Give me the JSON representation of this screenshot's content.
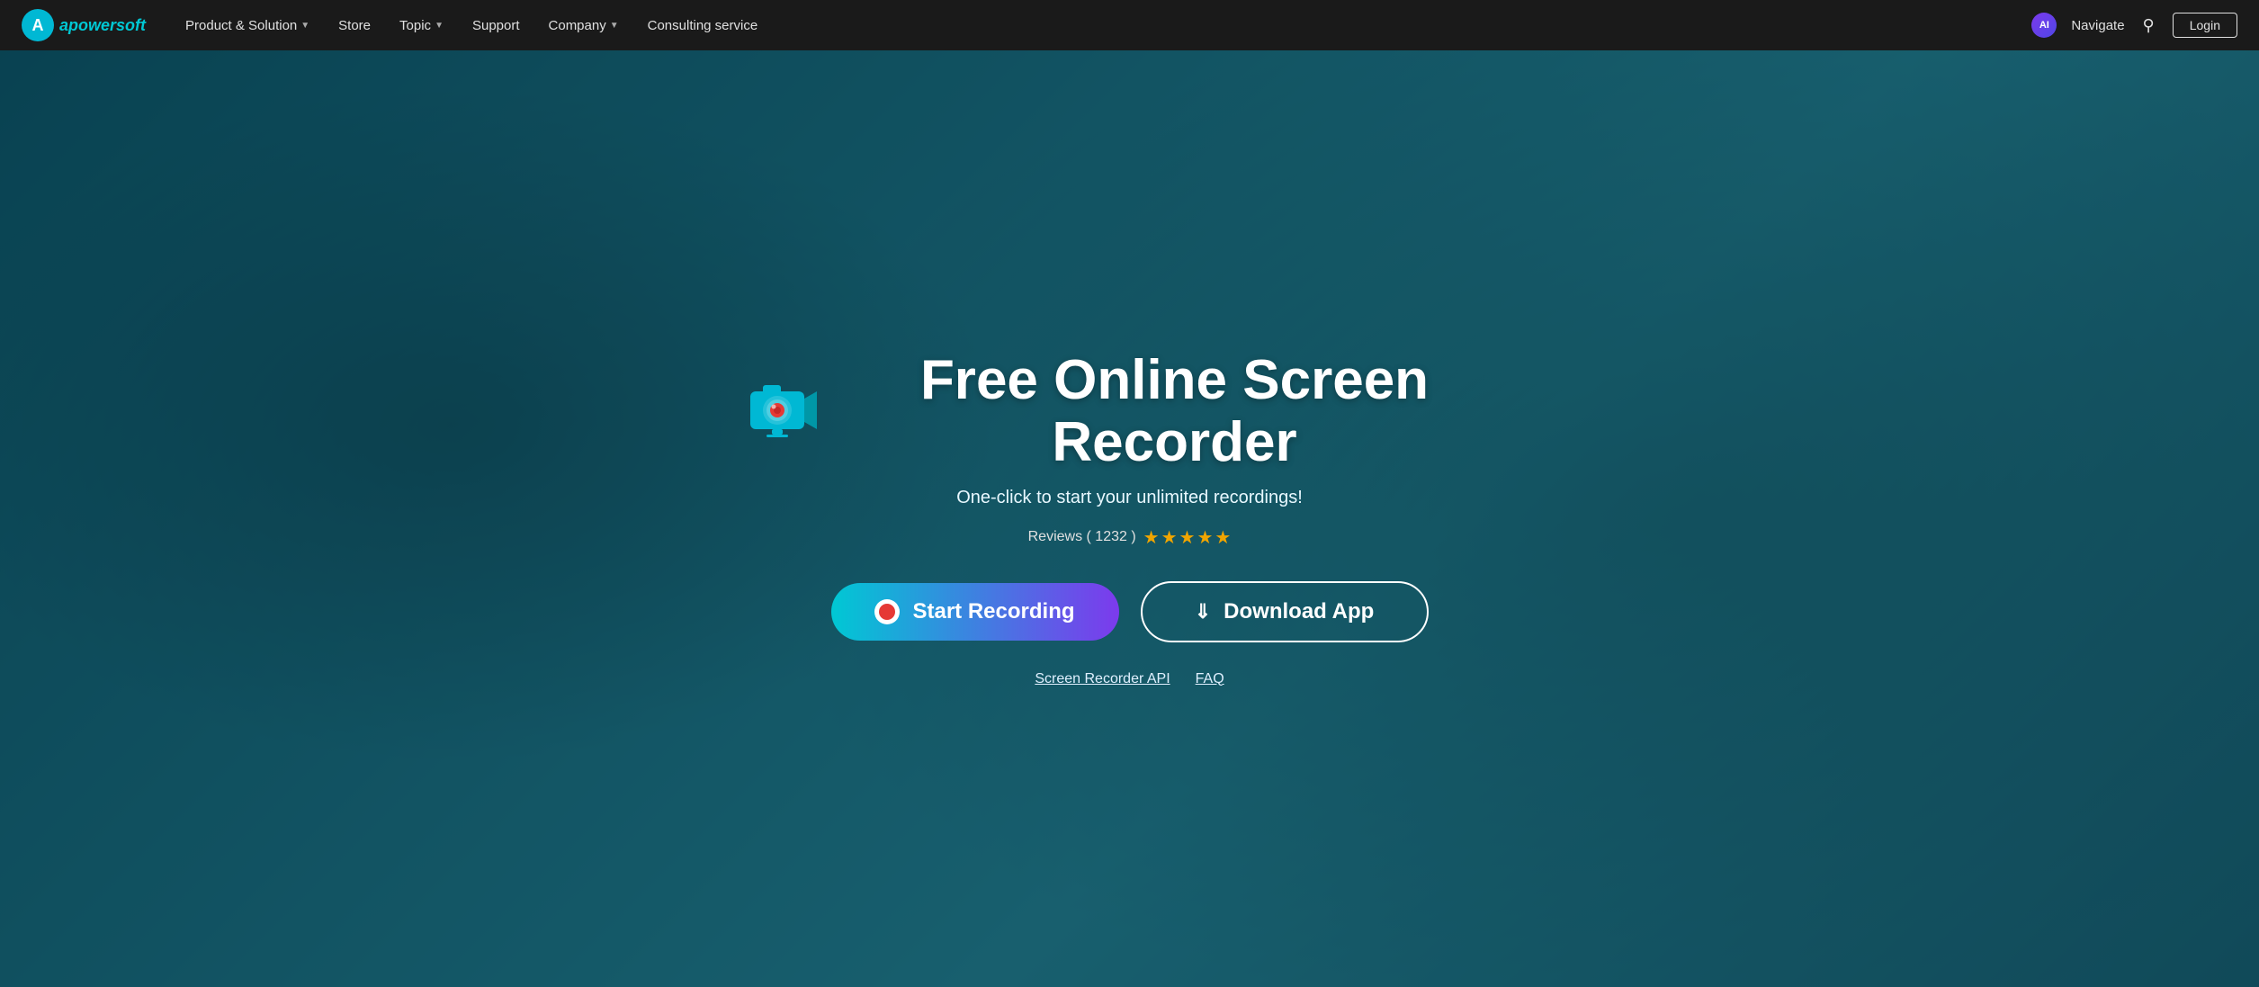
{
  "navbar": {
    "logo_text": "apowersoft",
    "items": [
      {
        "label": "Product & Solution",
        "has_dropdown": true
      },
      {
        "label": "Store",
        "has_dropdown": false
      },
      {
        "label": "Topic",
        "has_dropdown": true
      },
      {
        "label": "Support",
        "has_dropdown": false
      },
      {
        "label": "Company",
        "has_dropdown": true
      },
      {
        "label": "Consulting service",
        "has_dropdown": false
      }
    ],
    "ai_badge_text": "AI",
    "navigate_label": "Navigate",
    "search_icon": "🔍",
    "login_label": "Login"
  },
  "hero": {
    "title": "Free Online Screen Recorder",
    "subtitle": "One-click to start your unlimited recordings!",
    "reviews_label": "Reviews ( 1232 )",
    "star_count": 5,
    "btn_start_label": "Start Recording",
    "btn_download_label": "Download App",
    "link1_label": "Screen Recorder API",
    "link2_label": "FAQ"
  }
}
